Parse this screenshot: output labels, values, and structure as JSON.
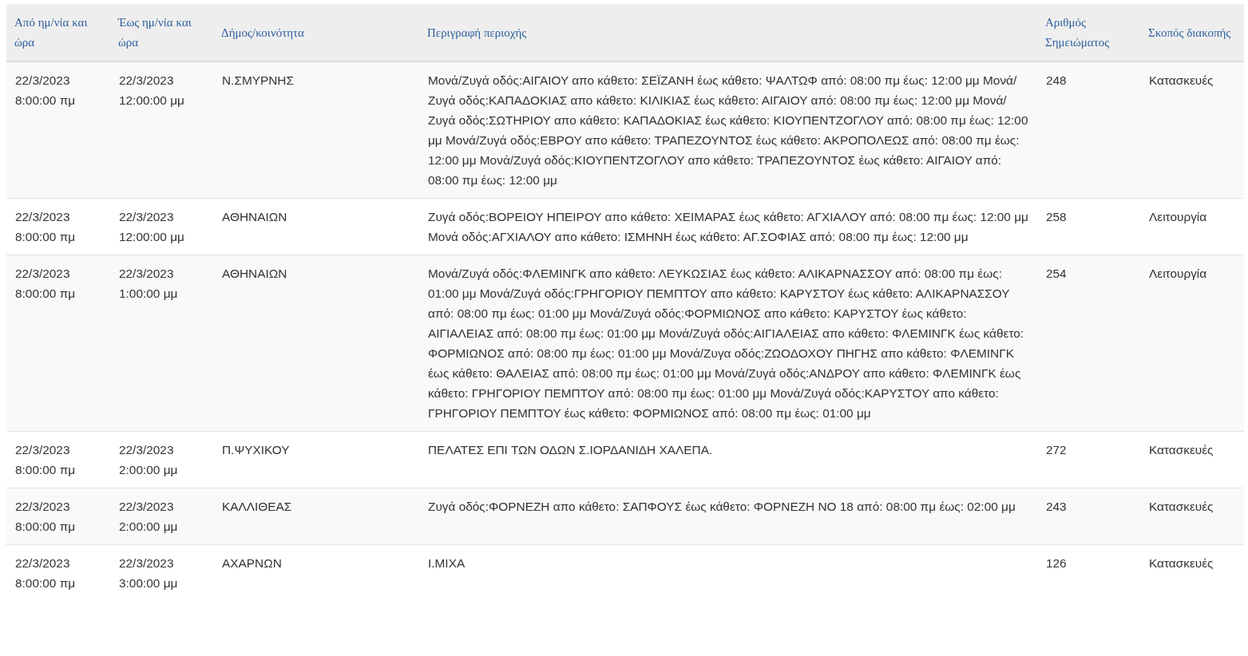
{
  "table": {
    "columns": [
      "Από ημ/νία και ώρα",
      "Έως ημ/νία και ώρα",
      "Δήμος/κοινότητα",
      "Περιγραφή περιοχής",
      "Αριθμός Σημειώματος",
      "Σκοπός διακοπής"
    ],
    "rows": [
      {
        "from": "22/3/2023 8:00:00 πμ",
        "to": "22/3/2023 12:00:00 μμ",
        "municipality": "Ν.ΣΜΥΡΝΗΣ",
        "description": "Μονά/Ζυγά οδός:ΑΙΓΑΙΟΥ απο κάθετο: ΣΕΪΖΑΝΗ έως κάθετο: ΨΑΛΤΩΦ από: 08:00 πμ έως: 12:00 μμ Μονά/Ζυγά οδός:ΚΑΠΑΔΟΚΙΑΣ απο κάθετο: ΚΙΛΙΚΙΑΣ έως κάθετο: ΑΙΓΑΙΟΥ από: 08:00 πμ έως: 12:00 μμ Μονά/Ζυγά οδός:ΣΩΤΗΡΙΟΥ απο κάθετο: ΚΑΠΑΔΟΚΙΑΣ έως κάθετο: ΚΙΟΥΠΕΝΤΖΟΓΛΟΥ από: 08:00 πμ έως: 12:00 μμ Μονά/Ζυγά οδός:ΕΒΡΟΥ απο κάθετο: ΤΡΑΠΕΖΟΥΝΤΟΣ έως κάθετο: ΑΚΡΟΠΟΛΕΩΣ από: 08:00 πμ έως: 12:00 μμ Μονά/Ζυγά οδός:ΚΙΟΥΠΕΝΤΖΟΓΛΟΥ απο κάθετο: ΤΡΑΠΕΖΟΥΝΤΟΣ έως κάθετο: ΑΙΓΑΙΟΥ από: 08:00 πμ έως: 12:00 μμ",
        "number": "248",
        "purpose": "Κατασκευές"
      },
      {
        "from": "22/3/2023 8:00:00 πμ",
        "to": "22/3/2023 12:00:00 μμ",
        "municipality": "ΑΘΗΝΑΙΩΝ",
        "description": "Ζυγά οδός:ΒΟΡΕΙΟΥ ΗΠΕΙΡΟΥ απο κάθετο: ΧΕΙΜΑΡΑΣ έως κάθετο: ΑΓΧΙΑΛΟΥ από: 08:00 πμ έως: 12:00 μμ Μονά οδός:ΑΓΧΙΑΛΟΥ απο κάθετο: ΙΣΜΗΝΗ έως κάθετο: ΑΓ.ΣΟΦΙΑΣ από: 08:00 πμ έως: 12:00 μμ",
        "number": "258",
        "purpose": "Λειτουργία"
      },
      {
        "from": "22/3/2023 8:00:00 πμ",
        "to": "22/3/2023 1:00:00 μμ",
        "municipality": "ΑΘΗΝΑΙΩΝ",
        "description": "Μονά/Ζυγά οδός:ΦΛΕΜΙΝΓΚ απο κάθετο: ΛΕΥΚΩΣΙΑΣ έως κάθετο: ΑΛΙΚΑΡΝΑΣΣΟΥ από: 08:00 πμ έως: 01:00 μμ Μονά/Ζυγά οδός:ΓΡΗΓΟΡΙΟΥ ΠΕΜΠΤΟΥ απο κάθετο: ΚΑΡΥΣΤΟΥ έως κάθετο: ΑΛΙΚΑΡΝΑΣΣΟΥ από: 08:00 πμ έως: 01:00 μμ Μονά/Ζυγά οδός:ΦΟΡΜΙΩΝΟΣ απο κάθετο: ΚΑΡΥΣΤΟΥ έως κάθετο: ΑΙΓΙΑΛΕΙΑΣ από: 08:00 πμ έως: 01:00 μμ Μονά/Ζυγά οδός:ΑΙΓΙΑΛΕΙΑΣ απο κάθετο: ΦΛΕΜΙΝΓΚ έως κάθετο: ΦΟΡΜΙΩΝΟΣ από: 08:00 πμ έως: 01:00 μμ Μονά/Ζυγα οδός:ΖΩΟΔΟΧΟΥ ΠΗΓΗΣ απο κάθετο: ΦΛΕΜΙΝΓΚ έως κάθετο: ΘΑΛΕΙΑΣ από: 08:00 πμ έως: 01:00 μμ Μονά/Ζυγά οδός:ΑΝΔΡΟΥ απο κάθετο: ΦΛΕΜΙΝΓΚ έως κάθετο: ΓΡΗΓΟΡΙΟΥ ΠΕΜΠΤΟΥ από: 08:00 πμ έως: 01:00 μμ Μονά/Ζυγά οδός:ΚΑΡΥΣΤΟΥ απο κάθετο: ΓΡΗΓΟΡΙΟΥ ΠΕΜΠΤΟΥ έως κάθετο: ΦΟΡΜΙΩΝΟΣ από: 08:00 πμ έως: 01:00 μμ",
        "number": "254",
        "purpose": "Λειτουργία"
      },
      {
        "from": "22/3/2023 8:00:00 πμ",
        "to": "22/3/2023 2:00:00 μμ",
        "municipality": "Π.ΨΥΧΙΚΟΥ",
        "description": "ΠΕΛΑΤΕΣ ΕΠΙ ΤΩΝ ΟΔΩΝ Σ.ΙΟΡΔΑΝΙΔΗ ΧΑΛΕΠΑ.",
        "number": "272",
        "purpose": "Κατασκευές"
      },
      {
        "from": "22/3/2023 8:00:00 πμ",
        "to": "22/3/2023 2:00:00 μμ",
        "municipality": "ΚΑΛΛΙΘΕΑΣ",
        "description": "Ζυγά οδός:ΦΟΡΝΕΖΗ απο κάθετο: ΣΑΠΦΟΥΣ έως κάθετο: ΦΟΡΝΕΖΗ ΝΟ 18 από: 08:00 πμ έως: 02:00 μμ",
        "number": "243",
        "purpose": "Κατασκευές"
      },
      {
        "from": "22/3/2023 8:00:00 πμ",
        "to": "22/3/2023 3:00:00 μμ",
        "municipality": "ΑΧΑΡΝΩΝ",
        "description": "Ι.ΜΙΧΑ",
        "number": "126",
        "purpose": "Κατασκευές"
      }
    ]
  }
}
